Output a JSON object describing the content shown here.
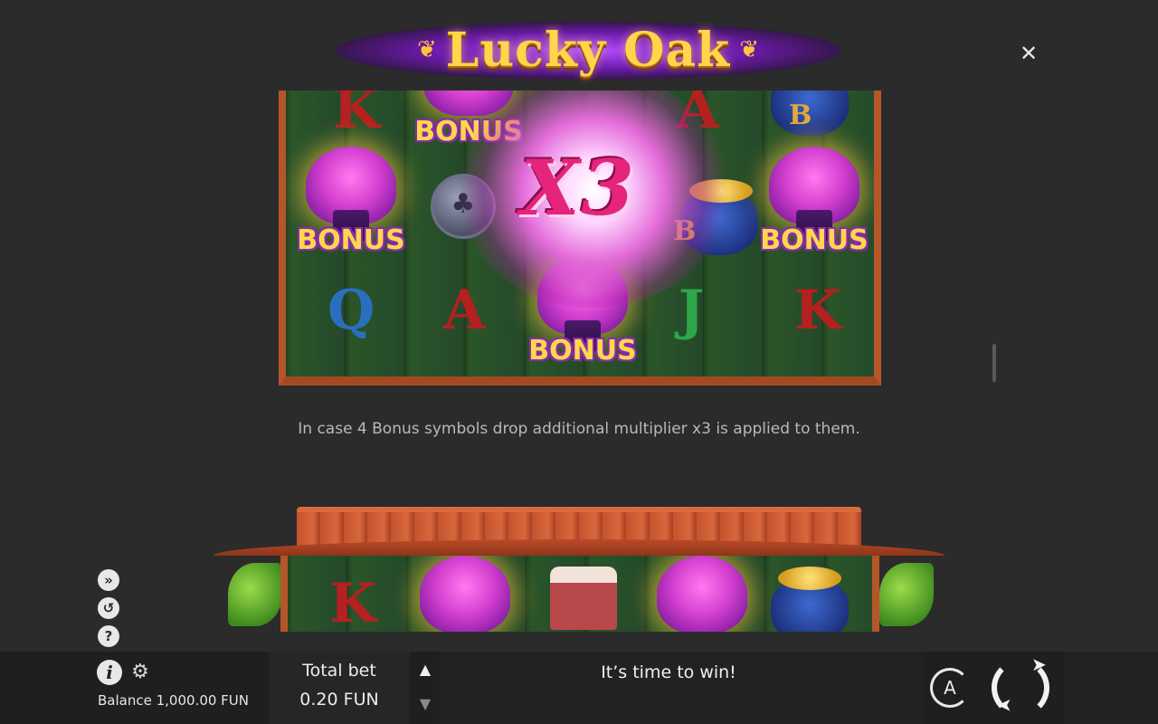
{
  "header": {
    "title": "Lucky Oak",
    "close_icon": "close-icon"
  },
  "screenshot_1": {
    "multiplier": "X3",
    "bonus_label": "BONUS",
    "letters": {
      "k_top": "K",
      "a_top": "A",
      "q": "Q",
      "a": "A",
      "j": "J",
      "k": "K"
    },
    "pot_letter": "B"
  },
  "caption": "In case 4 Bonus symbols drop additional multiplier x3 is applied to them.",
  "screenshot_2": {
    "k": "K"
  },
  "side_icons": [
    "turbo-icon",
    "history-icon",
    "help-icon"
  ],
  "bottom_bar": {
    "balance_label": "Balance",
    "balance_value": "1,000.00 FUN",
    "total_bet_label": "Total bet",
    "total_bet_value": "0.20 FUN",
    "message": "It’s time to win!",
    "autoplay_label": "A"
  },
  "colors": {
    "background": "#2b2b2b",
    "logo_gold": "#ffd54a",
    "logo_glow": "#b44cff",
    "multiplier_pink": "#e6247d",
    "frame_orange": "#b5562a"
  }
}
